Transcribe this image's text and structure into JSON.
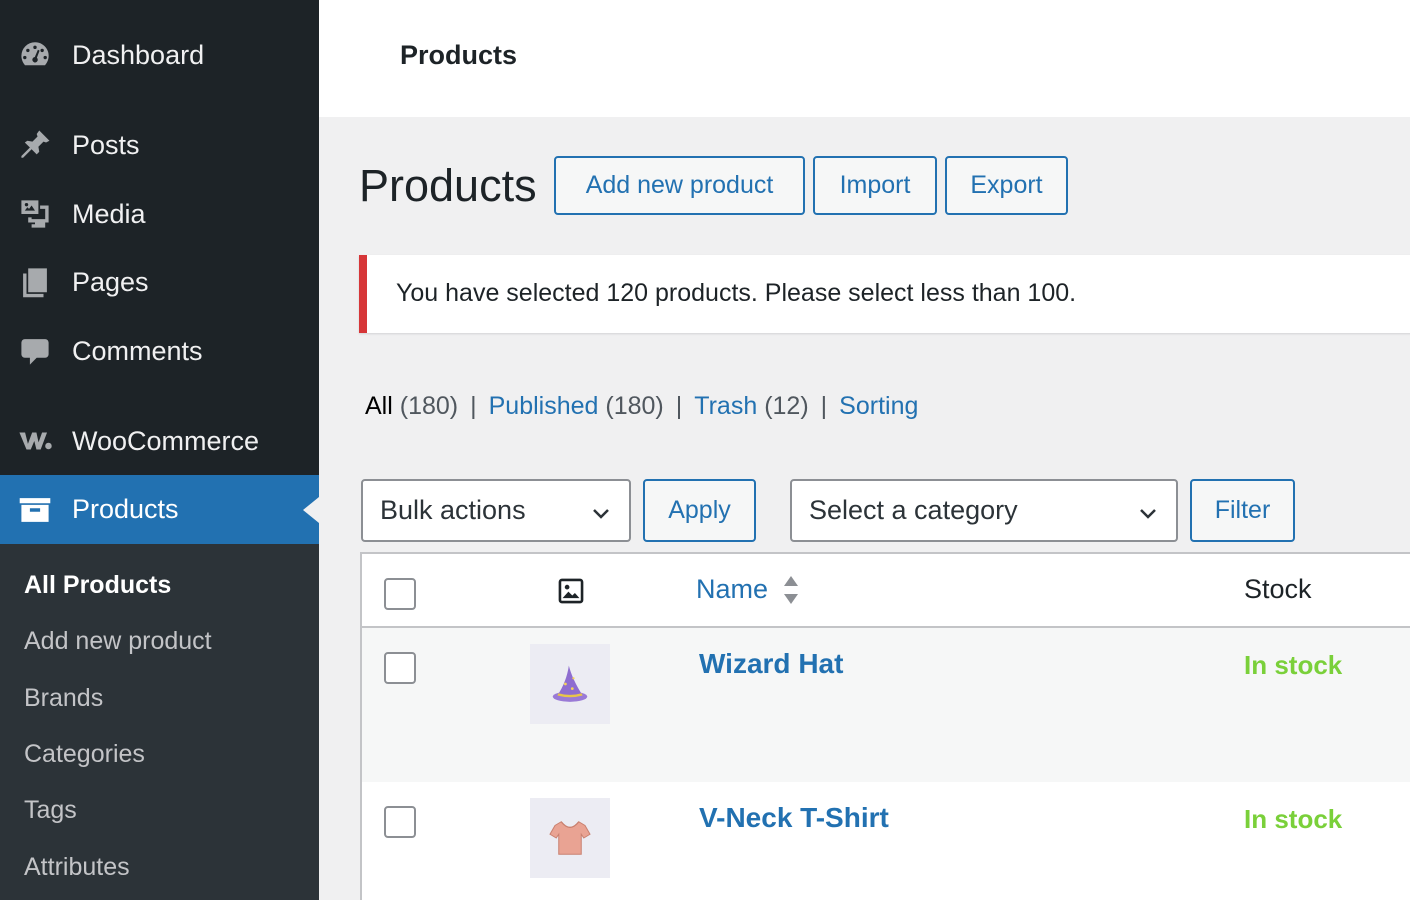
{
  "sidebar": {
    "items": [
      {
        "label": "Dashboard",
        "icon": "dashboard-icon"
      },
      {
        "label": "Posts",
        "icon": "pin-icon"
      },
      {
        "label": "Media",
        "icon": "media-icon"
      },
      {
        "label": "Pages",
        "icon": "pages-icon"
      },
      {
        "label": "Comments",
        "icon": "comment-icon"
      },
      {
        "label": "WooCommerce",
        "icon": "woocommerce-icon"
      },
      {
        "label": "Products",
        "icon": "archive-icon"
      }
    ],
    "submenu": [
      "All Products",
      "Add new product",
      "Brands",
      "Categories",
      "Tags",
      "Attributes"
    ]
  },
  "topbar": {
    "title": "Products"
  },
  "heading": {
    "title": "Products",
    "add_new": "Add new product",
    "import": "Import",
    "export": "Export"
  },
  "notice": {
    "text": "You have selected 120 products. Please select less than 100.",
    "color": "#d63638"
  },
  "views": {
    "all": "All",
    "all_count": "(180)",
    "published": "Published",
    "published_count": "(180)",
    "trash": "Trash",
    "trash_count": "(12)",
    "sorting": "Sorting",
    "separator": "|"
  },
  "filters": {
    "bulk_actions": "Bulk actions",
    "apply": "Apply",
    "category": "Select a category",
    "filter": "Filter"
  },
  "table": {
    "headers": {
      "thumb_icon": "image-icon",
      "name": "Name",
      "stock": "Stock"
    },
    "rows": [
      {
        "name": "Wizard Hat",
        "stock": "In stock",
        "thumb": "wizard-hat-thumbnail"
      },
      {
        "name": "V-Neck T-Shirt",
        "stock": "In stock",
        "thumb": "tshirt-thumbnail"
      }
    ]
  },
  "colors": {
    "accent": "#2271b1",
    "sidebar": "#1d2327",
    "in_stock": "#7ad03a"
  }
}
